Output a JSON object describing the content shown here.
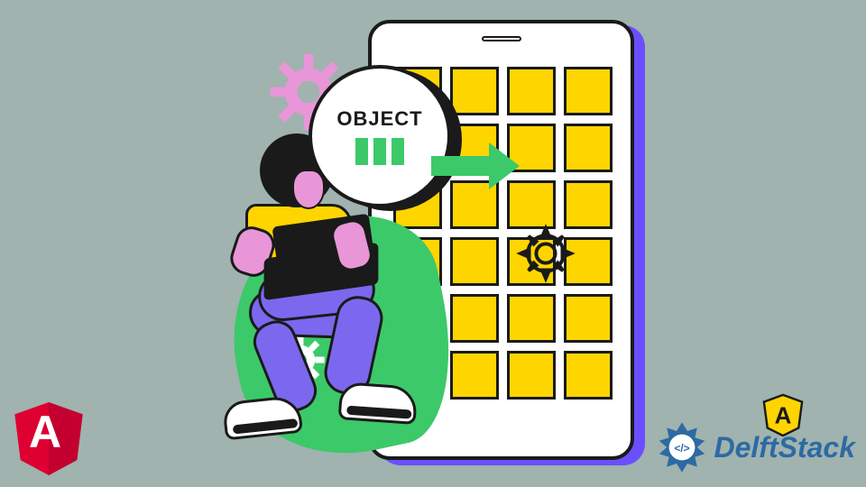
{
  "bubble": {
    "label": "OBJECT"
  },
  "brand": {
    "name": "DelftStack"
  },
  "colors": {
    "bg": "#a0b3ae",
    "accent_yellow": "#ffd500",
    "accent_green": "#3cc96a",
    "accent_purple": "#7b68ee",
    "accent_pink": "#e896d8",
    "accent_blue": "#2d6aa3",
    "angular_red": "#dd0031"
  },
  "angular": {
    "letter": "A"
  }
}
